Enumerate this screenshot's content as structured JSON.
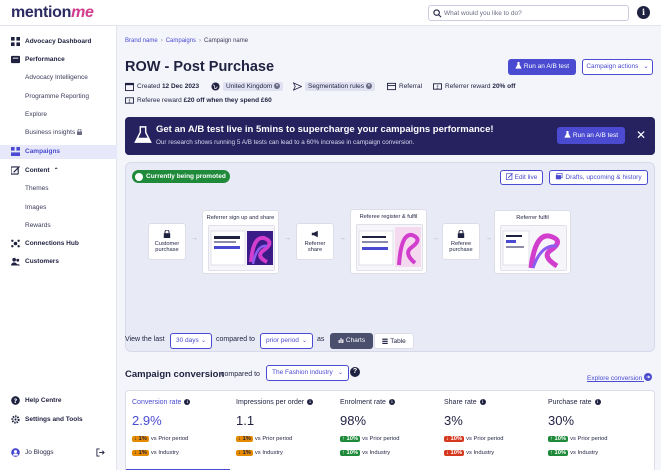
{
  "app": {
    "logo_text": "mention",
    "logo_suffix": "me"
  },
  "search": {
    "placeholder": "What would you like to do?"
  },
  "sidebar": {
    "items": [
      {
        "label": "Advocacy Dashboard"
      },
      {
        "label": "Performance"
      },
      {
        "label": "Advocacy Intelligence"
      },
      {
        "label": "Programme Reporting"
      },
      {
        "label": "Explore"
      },
      {
        "label": "Business insights"
      },
      {
        "label": "Campaigns"
      },
      {
        "label": "Content"
      },
      {
        "label": "Themes"
      },
      {
        "label": "Images"
      },
      {
        "label": "Rewards"
      },
      {
        "label": "Connections Hub"
      },
      {
        "label": "Customers"
      },
      {
        "label": "Help Centre"
      },
      {
        "label": "Settings and Tools"
      }
    ],
    "user": "Jo Bloggs"
  },
  "breadcrumb": {
    "brand": "Brand name",
    "campaigns": "Campaigns",
    "current": "Campaign name"
  },
  "page": {
    "title": "ROW - Post Purchase",
    "run_ab_test": "Run an A/B test",
    "campaign_actions": "Campaign actions"
  },
  "meta": {
    "created_label": "Created",
    "created_date": "12 Dec 2023",
    "country": "United Kingdom",
    "segmentation": "Segmentation rules",
    "referral": "Referral",
    "referrer_reward_label": "Referrer reward",
    "referrer_reward_value": "20% off",
    "referee_reward_label": "Referee reward",
    "referee_reward_value": "£20 off when they spend £60"
  },
  "banner": {
    "heading": "Get an A/B test live in 5mins to supercharge your campaigns performance!",
    "text": "Our research shows running 5 A/B tests can lead to a 60% increase in campaign conversion.",
    "button": "Run an A/B test"
  },
  "promo": {
    "status": "Currently being promoted",
    "edit_live": "Edit live",
    "drafts": "Drafts, upcoming & history",
    "flow": {
      "customer_purchase": "Customer purchase",
      "referrer_signup": "Referrer sign up and share",
      "referrer_share": "Referrer share",
      "referee_register": "Referee register & fulfil",
      "referee_purchase": "Referee purchase",
      "referrer_fulfil": "Referrer fulfil"
    }
  },
  "filters": {
    "view_the_last": "View the last",
    "days": "30 days",
    "compared_to": "compared to",
    "period": "prior period",
    "as": "as",
    "charts": "Charts",
    "table": "Table"
  },
  "conversion": {
    "title": "Campaign conversion",
    "compared_to": "compared to",
    "industry": "The Fashion industry",
    "explore": "Explore conversion",
    "metrics": [
      {
        "title": "Conversion rate",
        "value": "2.9%",
        "prior": "1%",
        "prior_label": "vs Prior period",
        "industry": "1%",
        "industry_label": "vs Industry"
      },
      {
        "title": "Impressions per order",
        "value": "1.1",
        "prior": "1%",
        "prior_label": "vs Prior period",
        "industry": "1%",
        "industry_label": "vs Industry"
      },
      {
        "title": "Enrolment rate",
        "value": "98%",
        "prior": "10%",
        "prior_label": "vs Prior period",
        "industry": "10%",
        "industry_label": "vs Industry"
      },
      {
        "title": "Share rate",
        "value": "3%",
        "prior": "10%",
        "prior_label": "vs Prior period",
        "industry": "10%",
        "industry_label": "vs Industry"
      },
      {
        "title": "Purchase rate",
        "value": "30%",
        "prior": "10%",
        "prior_label": "vs Prior period",
        "industry": "10%",
        "industry_label": "vs Industry"
      }
    ]
  },
  "colors": {
    "accent": "#4a4bd0",
    "banner": "#262260",
    "success": "#1e8a3a",
    "warning": "#e68a00",
    "danger": "#d4391f"
  }
}
